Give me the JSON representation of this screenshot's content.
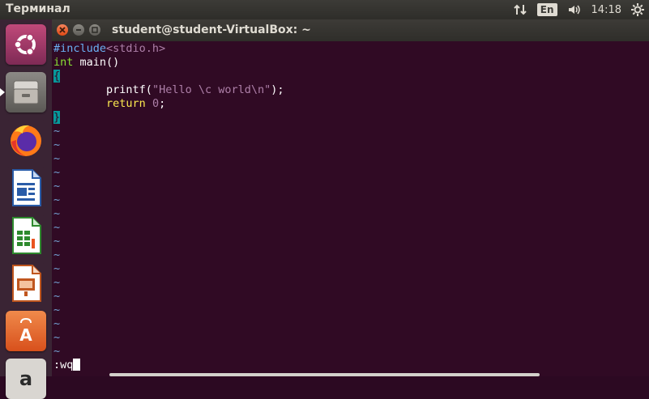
{
  "top_panel": {
    "app_title": "Терминал",
    "keyboard_layout": "En",
    "clock": "14:18"
  },
  "window": {
    "title": "student@student-VirtualBox: ~"
  },
  "editor": {
    "include_directive": "#include",
    "include_header": "<stdio.h>",
    "main_type": "int",
    "main_name": " main()",
    "open_brace": "{",
    "printf_indent": "        ",
    "printf_fn": "printf(",
    "printf_str": "\"Hello \\c world\\n\"",
    "printf_end": ");",
    "return_indent": "        ",
    "return_kw": "return",
    "return_val": " 0",
    "return_end": ";",
    "close_brace": "}",
    "empty_line_marker": "~",
    "command": ":wq"
  },
  "launcher": {
    "items": [
      "ubuntu-dash",
      "files",
      "firefox",
      "libreoffice-writer",
      "libreoffice-calc",
      "libreoffice-impress",
      "ubuntu-software",
      "amazon"
    ]
  },
  "colors": {
    "terminal_bg": "#300a24",
    "accent_orange": "#e95420"
  }
}
